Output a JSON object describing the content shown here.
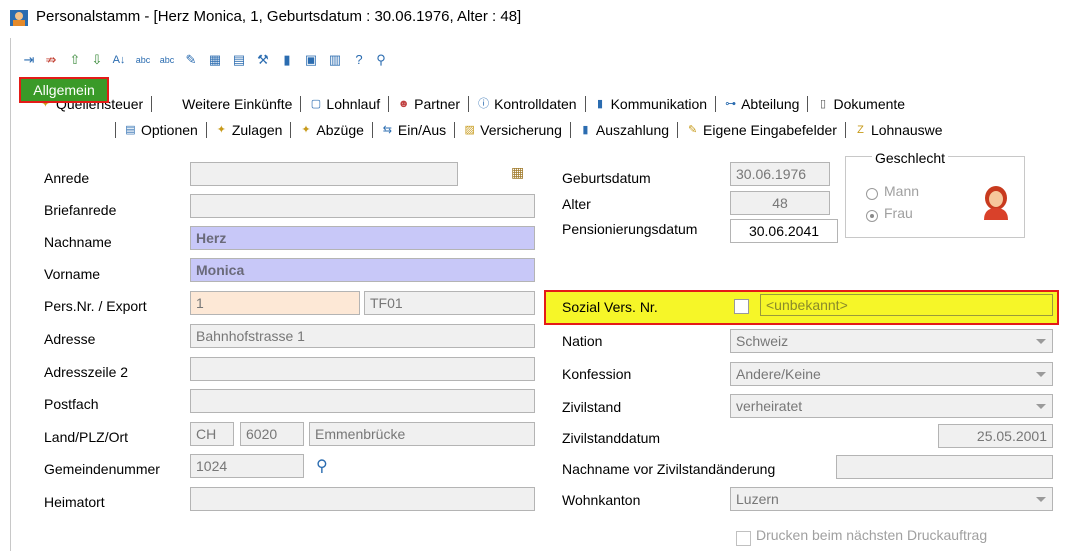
{
  "window": {
    "title": "Personalstamm - [Herz Monica, 1, Geburtsdatum : 30.06.1976, Alter : 48]"
  },
  "toolbar": {
    "icons": [
      "insert-row-icon",
      "delete-row-icon",
      "arrow-up-icon",
      "arrow-down-icon",
      "sort-az-icon",
      "spellcheck-icon",
      "spellcheck-small-icon",
      "edit-icon",
      "grid-icon",
      "grid-list-icon",
      "tools-icon",
      "book-icon",
      "save-icon",
      "calculator-icon",
      "help-icon",
      "search-icon"
    ]
  },
  "tabs": {
    "row1": [
      {
        "label": "Quellensteuer",
        "icon": "tax-icon"
      },
      {
        "label": "Weitere Einkünfte",
        "icon": ""
      },
      {
        "label": "Lohnlauf",
        "icon": "document-icon"
      },
      {
        "label": "Partner",
        "icon": "people-icon"
      },
      {
        "label": "Kontrolldaten",
        "icon": "info-icon"
      },
      {
        "label": "Kommunikation",
        "icon": "phone-icon"
      },
      {
        "label": "Abteilung",
        "icon": "org-icon"
      },
      {
        "label": "Dokumente",
        "icon": "doc-icon"
      }
    ],
    "row2": [
      {
        "label": "Optionen",
        "icon": "options-icon"
      },
      {
        "label": "Zulagen",
        "icon": "plus-money-icon"
      },
      {
        "label": "Abzüge",
        "icon": "minus-money-icon"
      },
      {
        "label": "Ein/Aus",
        "icon": "in-out-icon"
      },
      {
        "label": "Versicherung",
        "icon": "insurance-icon"
      },
      {
        "label": "Auszahlung",
        "icon": "payout-icon"
      },
      {
        "label": "Eigene Eingabefelder",
        "icon": "custom-fields-icon"
      },
      {
        "label": "Lohnauswe",
        "icon": "report-icon"
      }
    ],
    "active": "Allgemein"
  },
  "left": {
    "anrede": {
      "label": "Anrede",
      "value": ""
    },
    "briefanrede": {
      "label": "Briefanrede",
      "value": ""
    },
    "nachname": {
      "label": "Nachname",
      "value": "Herz"
    },
    "vorname": {
      "label": "Vorname",
      "value": "Monica"
    },
    "persnr": {
      "label": "Pers.Nr. / Export",
      "value": "1",
      "export": "TF01"
    },
    "adresse": {
      "label": "Adresse",
      "value": "Bahnhofstrasse 1"
    },
    "adresszeile2": {
      "label": "Adresszeile 2",
      "value": ""
    },
    "postfach": {
      "label": "Postfach",
      "value": ""
    },
    "landplzort": {
      "label": "Land/PLZ/Ort",
      "land": "CH",
      "plz": "6020",
      "ort": "Emmenbrücke"
    },
    "gemeindenummer": {
      "label": "Gemeindenummer",
      "value": "1024"
    },
    "heimatort": {
      "label": "Heimatort",
      "value": ""
    }
  },
  "right": {
    "geburtsdatum": {
      "label": "Geburtsdatum",
      "value": "30.06.1976"
    },
    "alter": {
      "label": "Alter",
      "value": "48"
    },
    "pensionierungsdatum": {
      "label": "Pensionierungsdatum",
      "value": "30.06.2041"
    },
    "geschlecht": {
      "title": "Geschlecht",
      "options": [
        "Mann",
        "Frau"
      ],
      "selected": "Frau"
    },
    "sozialvers": {
      "label": "Sozial Vers. Nr.",
      "value": "<unbekannt>"
    },
    "nation": {
      "label": "Nation",
      "value": "Schweiz"
    },
    "konfession": {
      "label": "Konfession",
      "value": "Andere/Keine"
    },
    "zivilstand": {
      "label": "Zivilstand",
      "value": "verheiratet"
    },
    "zivilstanddatum": {
      "label": "Zivilstanddatum",
      "value": "25.05.2001"
    },
    "nachnamevor": {
      "label": "Nachname vor Zivilstandänderung",
      "value": ""
    },
    "wohnkanton": {
      "label": "Wohnkanton",
      "value": "Luzern"
    },
    "drucken": {
      "label": "Drucken beim nächsten Druckauftrag"
    }
  },
  "colors": {
    "active_tab": "#3a9a28",
    "highlight": "#f6f628",
    "highlight_border": "#e41b17",
    "name_fields": "#c8c8f8"
  }
}
